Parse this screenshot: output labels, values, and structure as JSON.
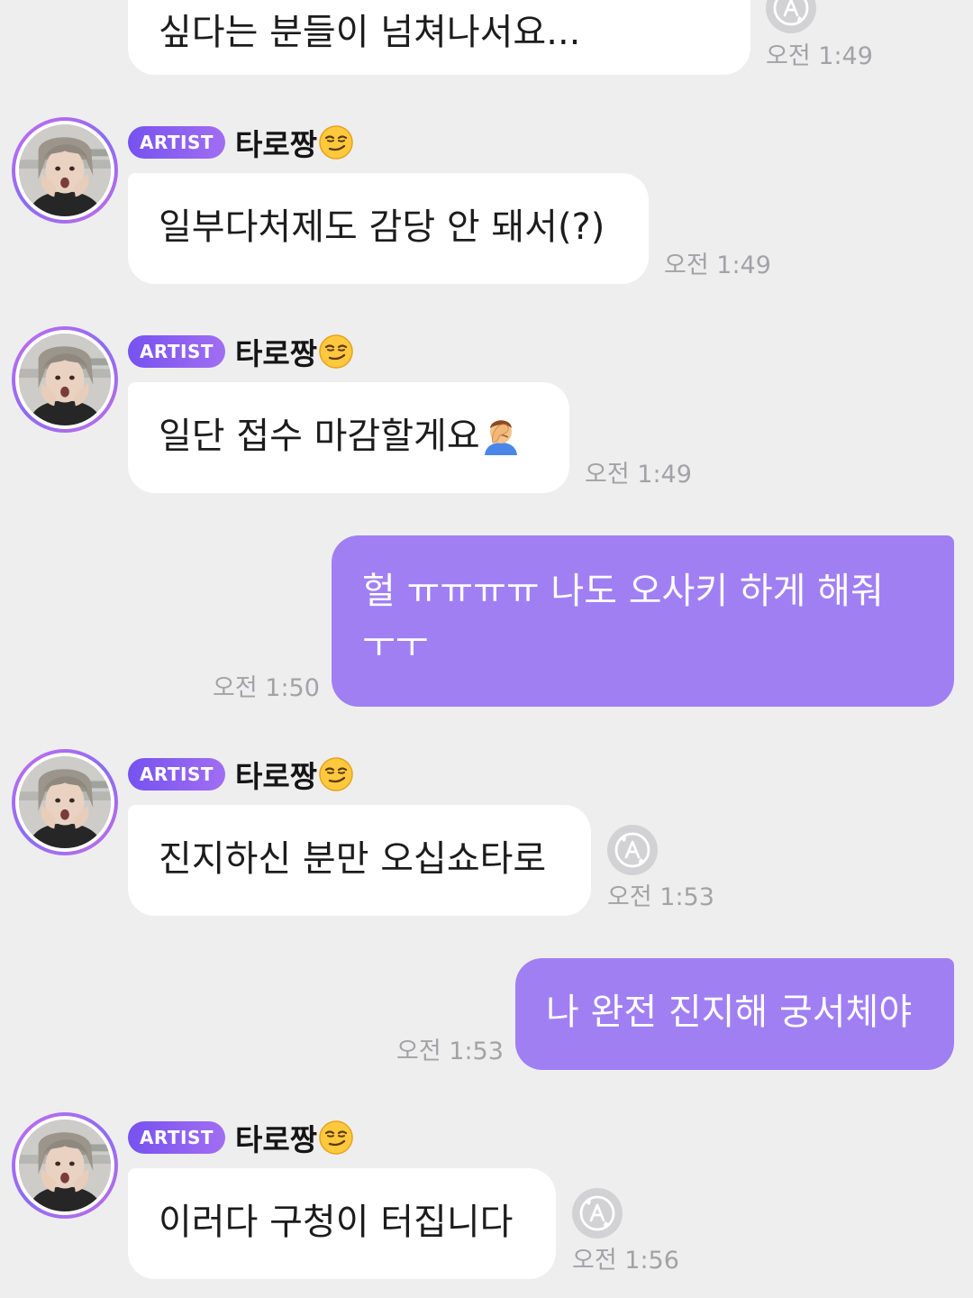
{
  "artist_badge_label": "ARTIST",
  "artist_name": "타로짱",
  "colors": {
    "background": "#eeeeef",
    "my_bubble": "#a07ff3",
    "artist_bubble": "#ffffff",
    "badge_gradient_start": "#7652f0",
    "badge_gradient_end": "#a16ef2",
    "timestamp": "#a3a3a6"
  },
  "icons": {
    "emoji_after_name": "smirking-face-emoji",
    "emoji_facepalm": "person-facepalming-emoji",
    "translate": "translate-a-icon"
  },
  "messages": [
    {
      "sender": "artist",
      "text": "싶다는 분들이 넘쳐나서요...",
      "time": "오전 1:49",
      "has_translate": true
    },
    {
      "sender": "artist",
      "text": "일부다처제도 감당 안 돼서(?)",
      "time": "오전 1:49",
      "has_translate": false
    },
    {
      "sender": "artist",
      "text": "일단 접수 마감할게요",
      "time": "오전 1:49",
      "has_translate": false
    },
    {
      "sender": "me",
      "text": "헐 ㅠㅠㅠㅠ 나도 오사키 하게 해줘 ㅜㅜ",
      "time": "오전 1:50"
    },
    {
      "sender": "artist",
      "text": "진지하신 분만 오십쇼타로",
      "time": "오전 1:53",
      "has_translate": true
    },
    {
      "sender": "me",
      "text": "나 완전 진지해 궁서체야",
      "time": "오전 1:53"
    },
    {
      "sender": "artist",
      "text": "이러다 구청이 터집니다",
      "time": "오전 1:56",
      "has_translate": true
    }
  ]
}
